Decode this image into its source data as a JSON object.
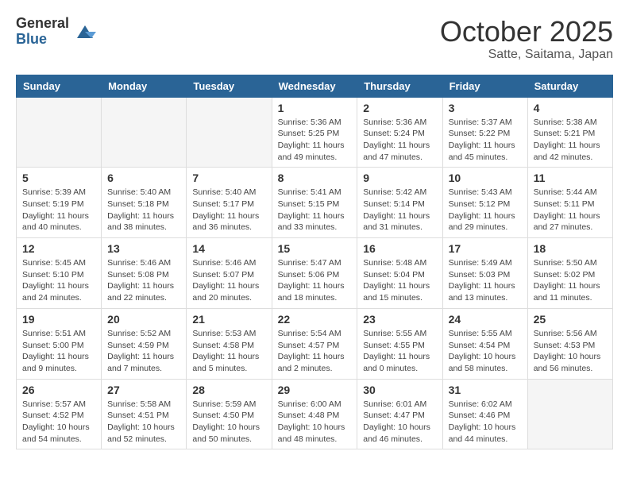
{
  "header": {
    "logo_general": "General",
    "logo_blue": "Blue",
    "month_title": "October 2025",
    "subtitle": "Satte, Saitama, Japan"
  },
  "weekdays": [
    "Sunday",
    "Monday",
    "Tuesday",
    "Wednesday",
    "Thursday",
    "Friday",
    "Saturday"
  ],
  "weeks": [
    [
      {
        "day": "",
        "info": ""
      },
      {
        "day": "",
        "info": ""
      },
      {
        "day": "",
        "info": ""
      },
      {
        "day": "1",
        "info": "Sunrise: 5:36 AM\nSunset: 5:25 PM\nDaylight: 11 hours\nand 49 minutes."
      },
      {
        "day": "2",
        "info": "Sunrise: 5:36 AM\nSunset: 5:24 PM\nDaylight: 11 hours\nand 47 minutes."
      },
      {
        "day": "3",
        "info": "Sunrise: 5:37 AM\nSunset: 5:22 PM\nDaylight: 11 hours\nand 45 minutes."
      },
      {
        "day": "4",
        "info": "Sunrise: 5:38 AM\nSunset: 5:21 PM\nDaylight: 11 hours\nand 42 minutes."
      }
    ],
    [
      {
        "day": "5",
        "info": "Sunrise: 5:39 AM\nSunset: 5:19 PM\nDaylight: 11 hours\nand 40 minutes."
      },
      {
        "day": "6",
        "info": "Sunrise: 5:40 AM\nSunset: 5:18 PM\nDaylight: 11 hours\nand 38 minutes."
      },
      {
        "day": "7",
        "info": "Sunrise: 5:40 AM\nSunset: 5:17 PM\nDaylight: 11 hours\nand 36 minutes."
      },
      {
        "day": "8",
        "info": "Sunrise: 5:41 AM\nSunset: 5:15 PM\nDaylight: 11 hours\nand 33 minutes."
      },
      {
        "day": "9",
        "info": "Sunrise: 5:42 AM\nSunset: 5:14 PM\nDaylight: 11 hours\nand 31 minutes."
      },
      {
        "day": "10",
        "info": "Sunrise: 5:43 AM\nSunset: 5:12 PM\nDaylight: 11 hours\nand 29 minutes."
      },
      {
        "day": "11",
        "info": "Sunrise: 5:44 AM\nSunset: 5:11 PM\nDaylight: 11 hours\nand 27 minutes."
      }
    ],
    [
      {
        "day": "12",
        "info": "Sunrise: 5:45 AM\nSunset: 5:10 PM\nDaylight: 11 hours\nand 24 minutes."
      },
      {
        "day": "13",
        "info": "Sunrise: 5:46 AM\nSunset: 5:08 PM\nDaylight: 11 hours\nand 22 minutes."
      },
      {
        "day": "14",
        "info": "Sunrise: 5:46 AM\nSunset: 5:07 PM\nDaylight: 11 hours\nand 20 minutes."
      },
      {
        "day": "15",
        "info": "Sunrise: 5:47 AM\nSunset: 5:06 PM\nDaylight: 11 hours\nand 18 minutes."
      },
      {
        "day": "16",
        "info": "Sunrise: 5:48 AM\nSunset: 5:04 PM\nDaylight: 11 hours\nand 15 minutes."
      },
      {
        "day": "17",
        "info": "Sunrise: 5:49 AM\nSunset: 5:03 PM\nDaylight: 11 hours\nand 13 minutes."
      },
      {
        "day": "18",
        "info": "Sunrise: 5:50 AM\nSunset: 5:02 PM\nDaylight: 11 hours\nand 11 minutes."
      }
    ],
    [
      {
        "day": "19",
        "info": "Sunrise: 5:51 AM\nSunset: 5:00 PM\nDaylight: 11 hours\nand 9 minutes."
      },
      {
        "day": "20",
        "info": "Sunrise: 5:52 AM\nSunset: 4:59 PM\nDaylight: 11 hours\nand 7 minutes."
      },
      {
        "day": "21",
        "info": "Sunrise: 5:53 AM\nSunset: 4:58 PM\nDaylight: 11 hours\nand 5 minutes."
      },
      {
        "day": "22",
        "info": "Sunrise: 5:54 AM\nSunset: 4:57 PM\nDaylight: 11 hours\nand 2 minutes."
      },
      {
        "day": "23",
        "info": "Sunrise: 5:55 AM\nSunset: 4:55 PM\nDaylight: 11 hours\nand 0 minutes."
      },
      {
        "day": "24",
        "info": "Sunrise: 5:55 AM\nSunset: 4:54 PM\nDaylight: 10 hours\nand 58 minutes."
      },
      {
        "day": "25",
        "info": "Sunrise: 5:56 AM\nSunset: 4:53 PM\nDaylight: 10 hours\nand 56 minutes."
      }
    ],
    [
      {
        "day": "26",
        "info": "Sunrise: 5:57 AM\nSunset: 4:52 PM\nDaylight: 10 hours\nand 54 minutes."
      },
      {
        "day": "27",
        "info": "Sunrise: 5:58 AM\nSunset: 4:51 PM\nDaylight: 10 hours\nand 52 minutes."
      },
      {
        "day": "28",
        "info": "Sunrise: 5:59 AM\nSunset: 4:50 PM\nDaylight: 10 hours\nand 50 minutes."
      },
      {
        "day": "29",
        "info": "Sunrise: 6:00 AM\nSunset: 4:48 PM\nDaylight: 10 hours\nand 48 minutes."
      },
      {
        "day": "30",
        "info": "Sunrise: 6:01 AM\nSunset: 4:47 PM\nDaylight: 10 hours\nand 46 minutes."
      },
      {
        "day": "31",
        "info": "Sunrise: 6:02 AM\nSunset: 4:46 PM\nDaylight: 10 hours\nand 44 minutes."
      },
      {
        "day": "",
        "info": ""
      }
    ]
  ]
}
